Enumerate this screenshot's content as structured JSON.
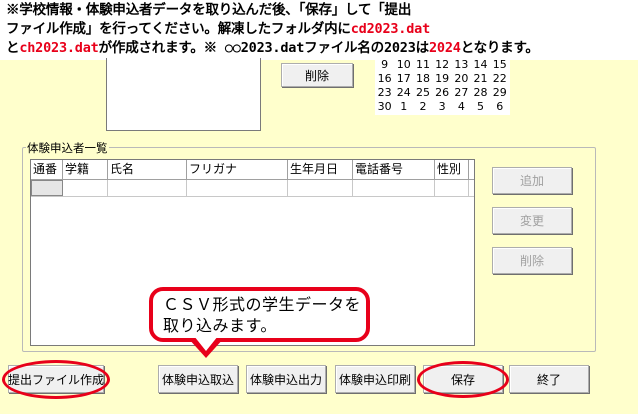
{
  "instruction": {
    "line1": "※学校情報・体験申込者データを取り込んだ後、「保存」して「提出",
    "line2_prefix": "ファイル作成」を行ってください。解凍したフォルダ内に",
    "line2_red": "cd2023.dat",
    "line3_prefix": "と",
    "line3_red1": "ch2023.dat",
    "line3_mid": "が作成されます。※ ○○2023.datファイル名の2023は",
    "line3_red2": "2024",
    "line3_suffix": "となります。"
  },
  "top": {
    "delete_label": "削除"
  },
  "calendar": {
    "rows": [
      [
        "9",
        "10",
        "11",
        "12",
        "13",
        "14",
        "15"
      ],
      [
        "16",
        "17",
        "18",
        "19",
        "20",
        "21",
        "22"
      ],
      [
        "23",
        "24",
        "25",
        "26",
        "27",
        "28",
        "29"
      ],
      [
        "30",
        "1",
        "2",
        "3",
        "4",
        "5",
        "6"
      ]
    ]
  },
  "group": {
    "title": "体験申込者一覧",
    "columns": [
      "通番",
      "学籍",
      "氏名",
      "フリガナ",
      "生年月日",
      "電話番号",
      "性別"
    ]
  },
  "side_buttons": {
    "add": "追加",
    "edit": "変更",
    "delete": "削除"
  },
  "callout": {
    "line1": "ＣＳＶ形式の学生データを",
    "line2": "取り込みます。"
  },
  "bottom_buttons": {
    "create_file": "提出ファイル作成",
    "import": "体験申込取込",
    "export": "体験申込出力",
    "print": "体験申込印刷",
    "save": "保存",
    "close": "終了"
  },
  "colors": {
    "background": "#ffffcc",
    "annotation_red": "#e8001a"
  }
}
